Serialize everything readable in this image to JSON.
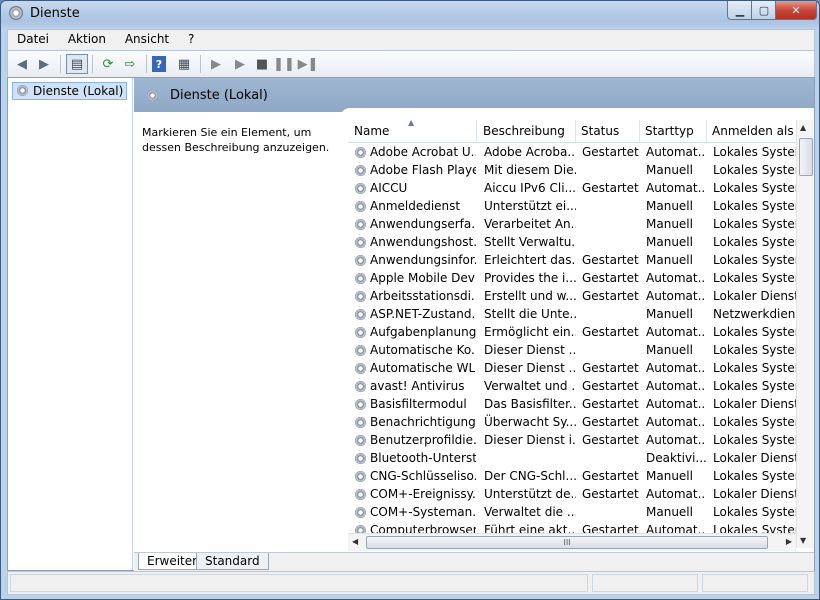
{
  "window": {
    "title": "Dienste"
  },
  "menu": [
    {
      "label": "Datei"
    },
    {
      "label": "Aktion"
    },
    {
      "label": "Ansicht"
    },
    {
      "label": "?"
    }
  ],
  "toolbar": [
    "back-icon",
    "forward-icon",
    "console-tree-icon",
    "refresh-icon",
    "export-icon",
    "help-icon",
    "properties-icon",
    "start-icon",
    "start-alt-icon",
    "stop-icon",
    "pause-icon",
    "restart-icon"
  ],
  "tree": {
    "node_label": "Dienste (Lokal)"
  },
  "panel": {
    "title": "Dienste (Lokal)",
    "description": "Markieren Sie ein Element, um dessen Beschreibung anzuzeigen."
  },
  "columns": [
    "Name",
    "Beschreibung",
    "Status",
    "Starttyp",
    "Anmelden als"
  ],
  "rows": [
    [
      "Adobe Acrobat U...",
      "Adobe Acroba...",
      "Gestartet",
      "Automat...",
      "Lokales System"
    ],
    [
      "Adobe Flash Playe...",
      "Mit diesem Die...",
      "",
      "Manuell",
      "Lokales System"
    ],
    [
      "AICCU",
      "Aiccu IPv6 Cli...",
      "Gestartet",
      "Automat...",
      "Lokales System"
    ],
    [
      "Anmeldedienst",
      "Unterstützt ei...",
      "",
      "Manuell",
      "Lokales System"
    ],
    [
      "Anwendungserfa...",
      "Verarbeitet An...",
      "",
      "Manuell",
      "Lokales System"
    ],
    [
      "Anwendungshost...",
      "Stellt Verwaltu...",
      "",
      "Manuell",
      "Lokales System"
    ],
    [
      "Anwendungsinfor...",
      "Erleichtert das...",
      "Gestartet",
      "Manuell",
      "Lokales System"
    ],
    [
      "Apple Mobile Devi...",
      "Provides the i...",
      "Gestartet",
      "Automat...",
      "Lokales System"
    ],
    [
      "Arbeitsstationsdi...",
      "Erstellt und w...",
      "Gestartet",
      "Automat...",
      "Lokaler Dienst"
    ],
    [
      "ASP.NET-Zustand...",
      "Stellt die Unte...",
      "",
      "Manuell",
      "Netzwerkdienst"
    ],
    [
      "Aufgabenplanung",
      "Ermöglicht ein...",
      "Gestartet",
      "Automat...",
      "Lokales System"
    ],
    [
      "Automatische Ko...",
      "Dieser Dienst ...",
      "",
      "Manuell",
      "Lokales System"
    ],
    [
      "Automatische WL...",
      "Dieser Dienst ...",
      "Gestartet",
      "Automat...",
      "Lokales System"
    ],
    [
      "avast! Antivirus",
      "Verwaltet und ...",
      "Gestartet",
      "Automat...",
      "Lokales System"
    ],
    [
      "Basisfiltermodul",
      "Das Basisfilter...",
      "Gestartet",
      "Automat...",
      "Lokaler Dienst"
    ],
    [
      "Benachrichtigung...",
      "Überwacht Sy...",
      "Gestartet",
      "Automat...",
      "Lokales System"
    ],
    [
      "Benutzerprofildie...",
      "Dieser Dienst i...",
      "Gestartet",
      "Automat...",
      "Lokales System"
    ],
    [
      "Bluetooth-Unterst...",
      "",
      "",
      "Deaktivi...",
      "Lokaler Dienst"
    ],
    [
      "CNG-Schlüsseliso...",
      "Der CNG-Schl...",
      "Gestartet",
      "Manuell",
      "Lokales System"
    ],
    [
      "COM+-Ereignissy...",
      "Unterstützt de...",
      "Gestartet",
      "Automat...",
      "Lokaler Dienst"
    ],
    [
      "COM+-Systeman...",
      "Verwaltet die ...",
      "",
      "Manuell",
      "Lokales System"
    ],
    [
      "Computerbrowser",
      "Führt eine akt...",
      "Gestartet",
      "Automat...",
      "Lokales System"
    ]
  ],
  "scroll": {
    "h_grip": "III"
  },
  "tabs": [
    {
      "label": "Erweitert"
    },
    {
      "label": "Standard"
    }
  ]
}
